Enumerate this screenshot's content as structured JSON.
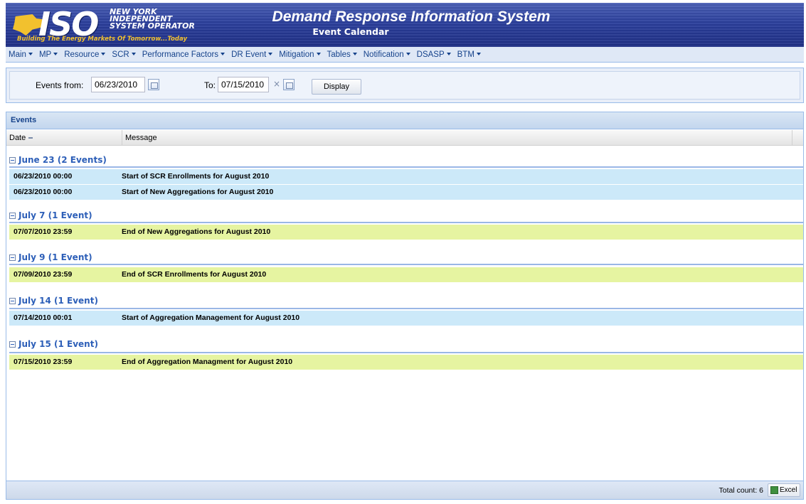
{
  "header": {
    "logo_text": "ISO",
    "logo_org_lines": [
      "NEW YORK",
      "INDEPENDENT",
      "SYSTEM OPERATOR"
    ],
    "logo_tagline": "Building The Energy Markets Of Tomorrow...Today",
    "title": "Demand Response Information System",
    "subtitle": "Event Calendar"
  },
  "menu": [
    {
      "label": "Main"
    },
    {
      "label": "MP"
    },
    {
      "label": "Resource"
    },
    {
      "label": "SCR"
    },
    {
      "label": "Performance Factors"
    },
    {
      "label": "DR Event"
    },
    {
      "label": "Mitigation"
    },
    {
      "label": "Tables"
    },
    {
      "label": "Notification"
    },
    {
      "label": "DSASP"
    },
    {
      "label": "BTM"
    }
  ],
  "filter": {
    "from_label": "Events from:",
    "from_value": "06/23/2010",
    "to_label": "To:",
    "to_value": "07/15/2010",
    "clear_glyph": "×",
    "display_button": "Display"
  },
  "grid": {
    "title": "Events",
    "columns": {
      "date": "Date",
      "message": "Message"
    },
    "groups": [
      {
        "label": "June 23 (2 Events)",
        "rows": [
          {
            "date": "06/23/2010 00:00",
            "message": "Start of SCR Enrollments for August 2010"
          },
          {
            "date": "06/23/2010 00:00",
            "message": "Start of New Aggregations for August 2010"
          }
        ]
      },
      {
        "label": "July 7 (1 Event)",
        "rows": [
          {
            "date": "07/07/2010 23:59",
            "message": "End of New Aggregations  for August 2010"
          }
        ]
      },
      {
        "label": "July 9 (1 Event)",
        "rows": [
          {
            "date": "07/09/2010 23:59",
            "message": "End of SCR Enrollments for August 2010"
          }
        ]
      },
      {
        "label": "July 14 (1 Event)",
        "rows": [
          {
            "date": "07/14/2010 00:01",
            "message": "Start of Aggregation Management for August 2010"
          }
        ]
      },
      {
        "label": "July 15 (1 Event)",
        "rows": [
          {
            "date": "07/15/2010 23:59",
            "message": "End of Aggregation Managment for August 2010"
          }
        ]
      }
    ],
    "footer": {
      "total_count": "Total count: 6",
      "excel_button": "Excel"
    }
  },
  "colors": {
    "banner": "#2b3f9c",
    "row_start": "#cce9f9",
    "row_end": "#e6f4a1",
    "group_title": "#2d5fb8"
  }
}
